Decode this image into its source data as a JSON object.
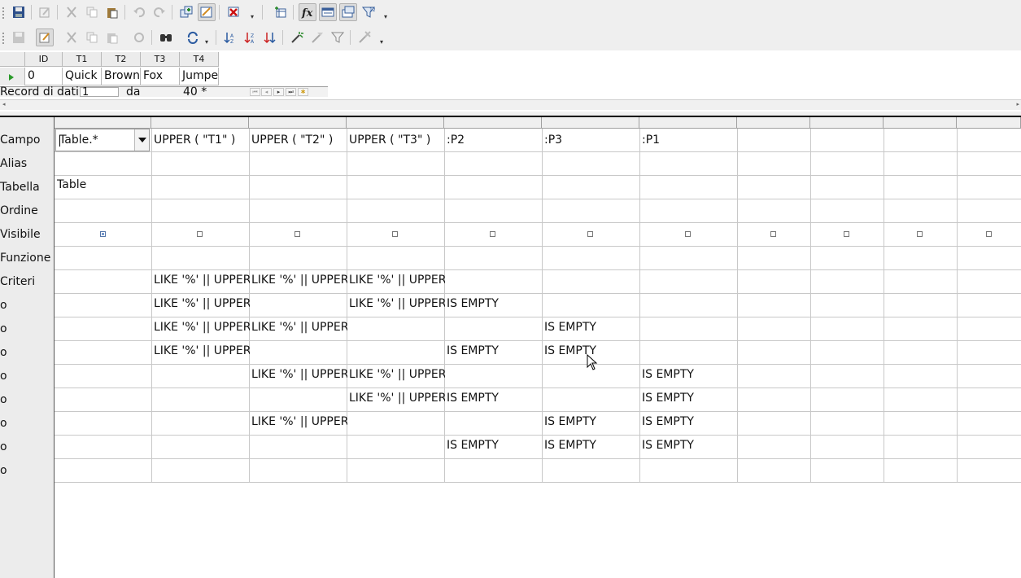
{
  "toolbar1": {
    "icons": [
      "save-icon",
      "edit-icon",
      "cut-icon",
      "copy-icon",
      "paste-icon",
      "undo-icon",
      "redo-icon",
      "add-tables-icon",
      "design-view-icon",
      "delete-icon",
      "insert-query-icon",
      "functions-icon",
      "table-name-icon",
      "alias-icon",
      "distinct-values-icon"
    ]
  },
  "toolbar2": {
    "icons": [
      "save-record-icon",
      "edit-data-icon",
      "cut-icon",
      "copy-icon",
      "paste-icon",
      "undo-record-icon",
      "find-record-icon",
      "refresh-icon",
      "sort-ascending-icon",
      "sort-descending-icon",
      "sort-icon",
      "autofilter-icon",
      "standard-filter-icon",
      "apply-filter-icon",
      "remove-filter-icon"
    ]
  },
  "preview": {
    "columns": [
      "ID",
      "T1",
      "T2",
      "T3",
      "T4"
    ],
    "row": [
      "0",
      "Quick",
      "Brown",
      "Fox",
      "Jumpe"
    ],
    "nav": {
      "label": "Record di dati",
      "current": "1",
      "of_label": "da",
      "total": "40 *"
    }
  },
  "design": {
    "row_labels": [
      "Campo",
      "Alias",
      "Tabella",
      "Ordine",
      "Visibile",
      "Funzione",
      "Criteri",
      "o",
      "o",
      "o",
      "o",
      "o",
      "o",
      "o",
      "o"
    ],
    "fields": [
      "Table.*",
      "UPPER ( \"T1\" )",
      "UPPER ( \"T2\" )",
      "UPPER ( \"T3\" )",
      ":P2",
      ":P3",
      ":P1",
      "",
      "",
      "",
      ""
    ],
    "table_row": [
      "Table",
      "",
      "",
      "",
      "",
      "",
      "",
      "",
      "",
      "",
      ""
    ],
    "visible": [
      true,
      false,
      false,
      false,
      false,
      false,
      false,
      false,
      false,
      false,
      false
    ],
    "criteria": [
      [
        "",
        "LIKE '%' || UPPER",
        "LIKE '%' || UPPER",
        "LIKE '%' || UPPER",
        "",
        "",
        "",
        "",
        "",
        "",
        ""
      ],
      [
        "",
        "LIKE '%' || UPPER",
        "",
        "LIKE '%' || UPPER",
        "IS EMPTY",
        "",
        "",
        "",
        "",
        "",
        ""
      ],
      [
        "",
        "LIKE '%' || UPPER",
        "LIKE '%' || UPPER",
        "",
        "",
        "IS EMPTY",
        "",
        "",
        "",
        "",
        ""
      ],
      [
        "",
        "LIKE '%' || UPPER",
        "",
        "",
        "IS EMPTY",
        "IS EMPTY",
        "",
        "",
        "",
        "",
        ""
      ],
      [
        "",
        "",
        "LIKE '%' || UPPER",
        "LIKE '%' || UPPER",
        "",
        "",
        "IS EMPTY",
        "",
        "",
        "",
        ""
      ],
      [
        "",
        "",
        "",
        "LIKE '%' || UPPER",
        "IS EMPTY",
        "",
        "IS EMPTY",
        "",
        "",
        "",
        ""
      ],
      [
        "",
        "",
        "LIKE '%' || UPPER",
        "",
        "",
        "IS EMPTY",
        "IS EMPTY",
        "",
        "",
        "",
        ""
      ],
      [
        "",
        "",
        "",
        "",
        "IS EMPTY",
        "IS EMPTY",
        "IS EMPTY",
        "",
        "",
        "",
        ""
      ],
      [
        "",
        "",
        "",
        "",
        "",
        "",
        "",
        "",
        "",
        "",
        ""
      ]
    ]
  }
}
